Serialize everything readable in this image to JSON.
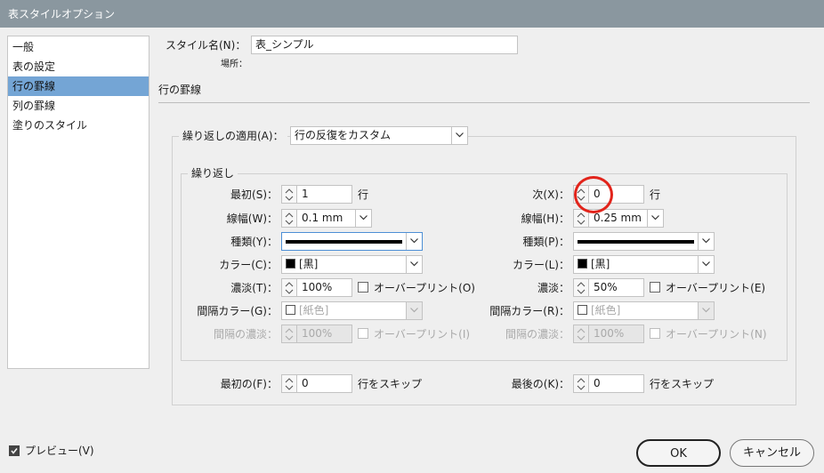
{
  "window": {
    "title": "表スタイルオプション"
  },
  "sidebar": {
    "items": [
      {
        "label": "一般"
      },
      {
        "label": "表の設定"
      },
      {
        "label": "行の罫線"
      },
      {
        "label": "列の罫線"
      },
      {
        "label": "塗りのスタイル"
      }
    ],
    "selected": "行の罫線"
  },
  "style": {
    "name_label": "スタイル名(N)：",
    "name_value": "表_シンプル",
    "location_label": "場所："
  },
  "section": {
    "title": "行の罫線"
  },
  "alternating": {
    "label": "繰り返しの適用(A)：",
    "value": "行の反復をカスタム"
  },
  "repeat_group": {
    "label": "繰り返し"
  },
  "left": {
    "first_label": "最初(S)：",
    "first_value": "1",
    "first_unit": "行",
    "weight_label": "線幅(W)：",
    "weight_value": "0.1 mm",
    "type_label": "種類(Y)：",
    "color_label": "カラー(C)：",
    "color_value": "[黒]",
    "tint_label": "濃淡(T)：",
    "tint_value": "100%",
    "overprint_label": "オーバープリント(O)",
    "gap_color_label": "間隔カラー(G)：",
    "gap_color_value": "[紙色]",
    "gap_tint_label": "間隔の濃淡：",
    "gap_tint_value": "100%",
    "gap_overprint_label": "オーバープリント(I)"
  },
  "right": {
    "next_label": "次(X)：",
    "next_value": "0",
    "next_unit": "行",
    "weight_label": "線幅(H)：",
    "weight_value": "0.25 mm",
    "type_label": "種類(P)：",
    "color_label": "カラー(L)：",
    "color_value": "[黒]",
    "tint_label": "濃淡：",
    "tint_value": "50%",
    "overprint_label": "オーバープリント(E)",
    "gap_color_label": "間隔カラー(R)：",
    "gap_color_value": "[紙色]",
    "gap_tint_label": "間隔の濃淡：",
    "gap_tint_value": "100%",
    "gap_overprint_label": "オーバープリント(N)"
  },
  "skip": {
    "first_label": "最初の(F)：",
    "first_value": "0",
    "first_unit": "行をスキップ",
    "last_label": "最後の(K)：",
    "last_value": "0",
    "last_unit": "行をスキップ"
  },
  "footer": {
    "preview_label": "プレビュー(V)",
    "preview_checked": true,
    "ok_label": "OK",
    "cancel_label": "キャンセル"
  },
  "colors": {
    "titlebar": "#8a979f",
    "selection": "#74a5d5",
    "highlight": "#e2241b"
  }
}
